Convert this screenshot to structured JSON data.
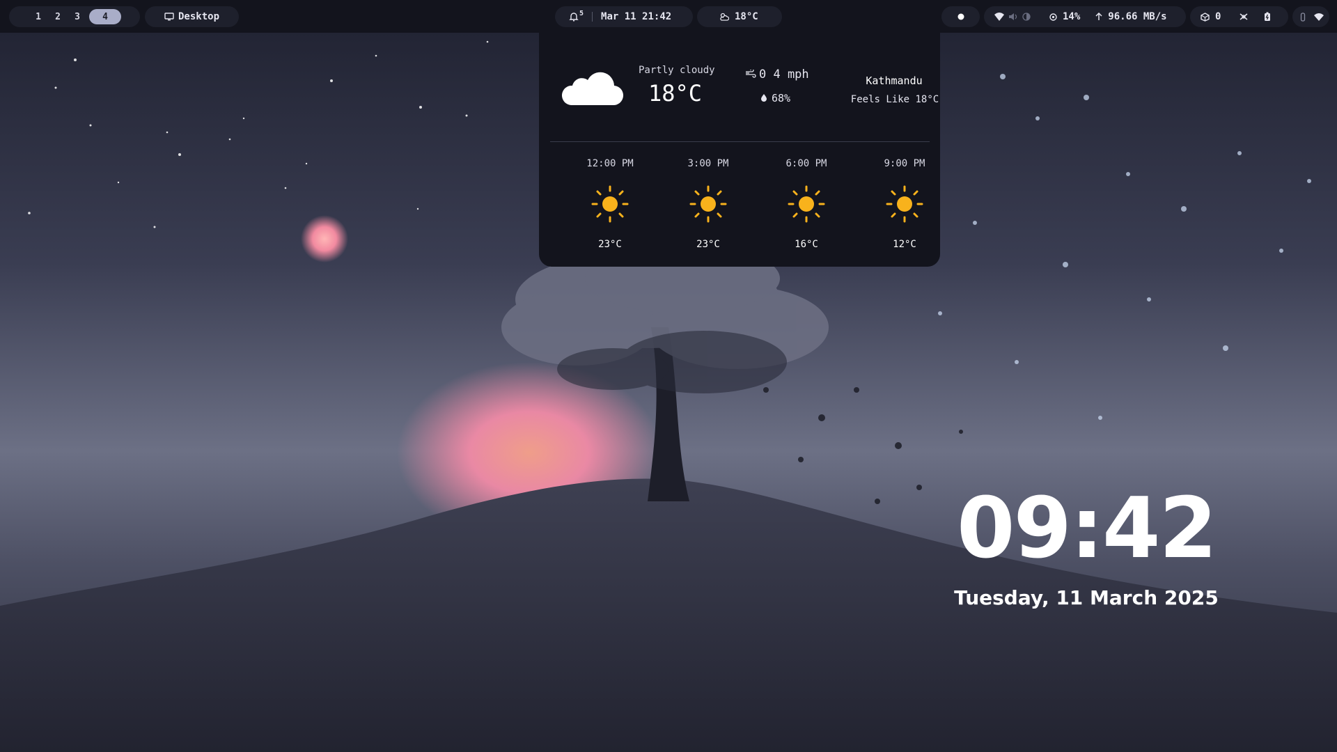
{
  "topbar": {
    "workspaces": [
      {
        "label": "1",
        "active": false
      },
      {
        "label": "2",
        "active": false
      },
      {
        "label": "3",
        "active": false
      },
      {
        "label": "4",
        "active": true
      }
    ],
    "window": {
      "icon": "monitor-icon",
      "label": "Desktop"
    },
    "notifications": {
      "icon": "bell-icon",
      "count": "5"
    },
    "datetime": "Mar 11 21:42",
    "weather": {
      "icon": "cloud-sun-icon",
      "temp": "18°C"
    },
    "record": {
      "icon": "record-dot-icon"
    },
    "network": {
      "wifi_icon": "wifi-icon",
      "volume_icon": "volume-icon",
      "brightness_icon": "brightness-icon"
    },
    "cpu": {
      "icon": "cpu-icon",
      "value": "14%"
    },
    "net_speed": {
      "icon": "arrow-up-icon",
      "value": "96.66 MB/s"
    },
    "updates": {
      "icon": "package-icon",
      "value": "0"
    },
    "tray": {
      "bluetooth_icon": "bluetooth-icon",
      "battery_icon": "battery-icon",
      "mic_icon": "mic-icon",
      "wifi_icon": "wifi-icon"
    }
  },
  "weather_popup": {
    "current": {
      "icon": "cloud-icon",
      "condition": "Partly cloudy",
      "temperature": "18°C",
      "wind_icon": "wind-icon",
      "wind": "0 4 mph",
      "humidity_icon": "droplet-icon",
      "humidity": "68%",
      "location": "Kathmandu",
      "feels_like": "Feels Like 18°C"
    },
    "forecast": [
      {
        "time": "12:00 PM",
        "icon": "sun-icon",
        "temp": "23°C"
      },
      {
        "time": "3:00 PM",
        "icon": "sun-icon",
        "temp": "23°C"
      },
      {
        "time": "6:00 PM",
        "icon": "sun-icon",
        "temp": "16°C"
      },
      {
        "time": "9:00 PM",
        "icon": "sun-icon",
        "temp": "12°C"
      }
    ]
  },
  "desktop_clock": {
    "time": "09:42",
    "date": "Tuesday, 11 March 2025"
  },
  "colors": {
    "bar_bg": "#13141d",
    "pill_bg": "#1e202c",
    "active_workspace": "#a9adc8",
    "sun": "#f8b21c",
    "sunset_pink": "#f28aa4"
  }
}
